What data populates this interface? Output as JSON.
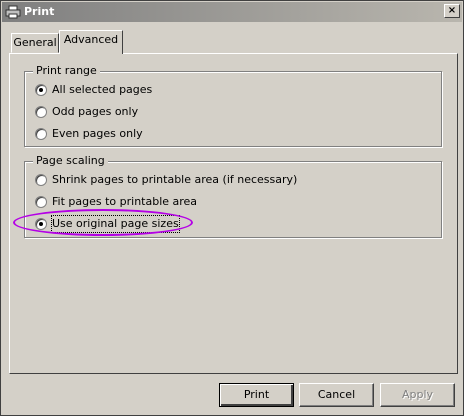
{
  "window": {
    "title": "Print",
    "close_symbol": "×"
  },
  "tabs": [
    {
      "label": "General",
      "selected": false
    },
    {
      "label": "Advanced",
      "selected": true
    }
  ],
  "print_range": {
    "title": "Print range",
    "options": [
      {
        "label": "All selected pages",
        "selected": true
      },
      {
        "label": "Odd pages only",
        "selected": false
      },
      {
        "label": "Even pages only",
        "selected": false
      }
    ]
  },
  "page_scaling": {
    "title": "Page scaling",
    "options": [
      {
        "label": "Shrink pages to printable area (if necessary)",
        "selected": false
      },
      {
        "label": "Fit pages to printable area",
        "selected": false
      },
      {
        "label": "Use original page sizes",
        "selected": true
      }
    ]
  },
  "buttons": {
    "print": "Print",
    "cancel": "Cancel",
    "apply": "Apply"
  },
  "colors": {
    "highlight": "#b400e6"
  },
  "icons": {
    "title": "printer-icon",
    "close": "close-icon"
  }
}
